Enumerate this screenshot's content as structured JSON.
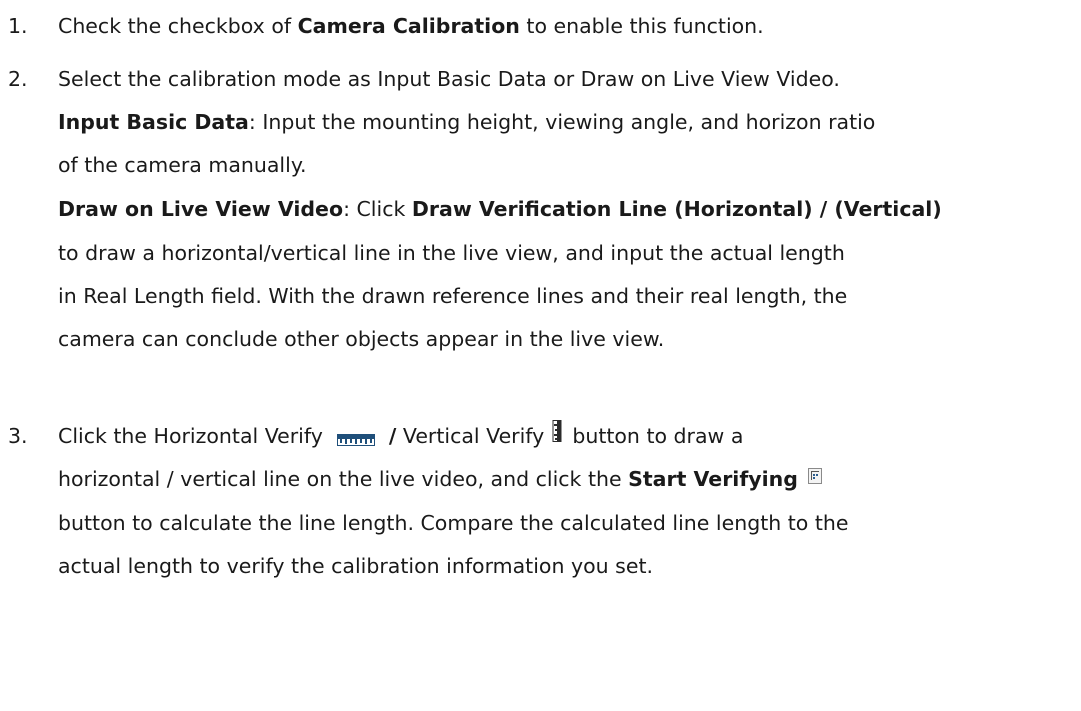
{
  "steps": [
    {
      "number": "1.",
      "lines": [
        {
          "t1": "Check the checkbox of ",
          "b1": "Camera Calibration",
          "t2": " to enable this function."
        }
      ]
    },
    {
      "number": "2.",
      "lines": [
        {
          "t1": "Select the calibration mode as Input Basic Data or Draw on Live View Video."
        },
        {
          "b1": "Input Basic Data",
          "t1": ": Input the mounting height, viewing angle, and horizon ratio"
        },
        {
          "t1": "of the camera manually."
        },
        {
          "b1": "Draw on Live View Video",
          "t1": ": Click ",
          "b2": "Draw Verification Line (Horizontal) / (Vertical)"
        },
        {
          "t1": "to draw a horizontal/vertical line in the live view, and input the actual length"
        },
        {
          "t1": "in Real Length field. With the drawn reference lines and their real length, the"
        },
        {
          "t1": "camera can conclude other objects appear in the live view."
        }
      ]
    },
    {
      "number": "3.",
      "lines": [
        {
          "t1": "Click the Horizontal Verify",
          "b1": "/",
          "t2": " Vertical Verify",
          "t3": "button to draw a"
        },
        {
          "t1": "horizontal / vertical line on the live video, and click the ",
          "b1": "Start Verifying"
        },
        {
          "t1": "button to calculate the line length. Compare the calculated line length to the"
        },
        {
          "t1": "actual length to verify the calibration information you set."
        }
      ]
    }
  ],
  "icons": {
    "horizontal_verify": "horizontal-ruler-icon",
    "vertical_verify": "vertical-ruler-icon",
    "start_verifying": "start-verifying-icon"
  }
}
